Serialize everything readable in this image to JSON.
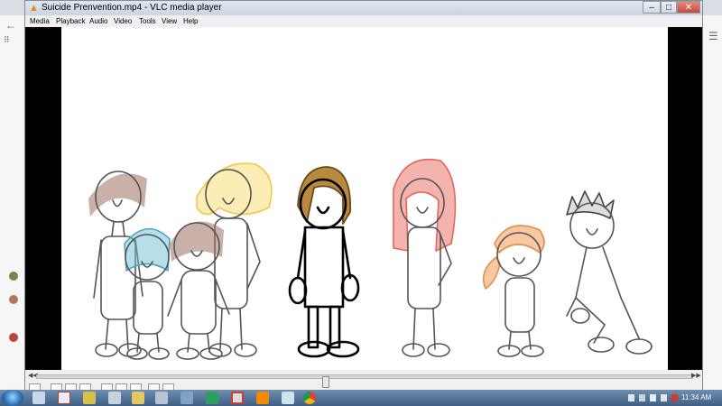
{
  "window": {
    "title": "Suicide Prenvention.mp4 - VLC media player",
    "controls": {
      "minimize": "–",
      "maximize": "□",
      "close": "✕"
    }
  },
  "menu": [
    "Media",
    "Playback",
    "Audio",
    "Video",
    "Tools",
    "View",
    "Help"
  ],
  "player": {
    "seek_fraction": 0.44
  },
  "taskbar": {
    "time": "11:34 AM"
  },
  "icons": {
    "vlc": "traffic-cone-icon",
    "start": "windows-start-icon"
  },
  "colors": {
    "vlc_orange": "#f08a00",
    "taskbar": "#4a6b90",
    "video_bg": "#000000",
    "frame_bg": "#ffffff"
  }
}
